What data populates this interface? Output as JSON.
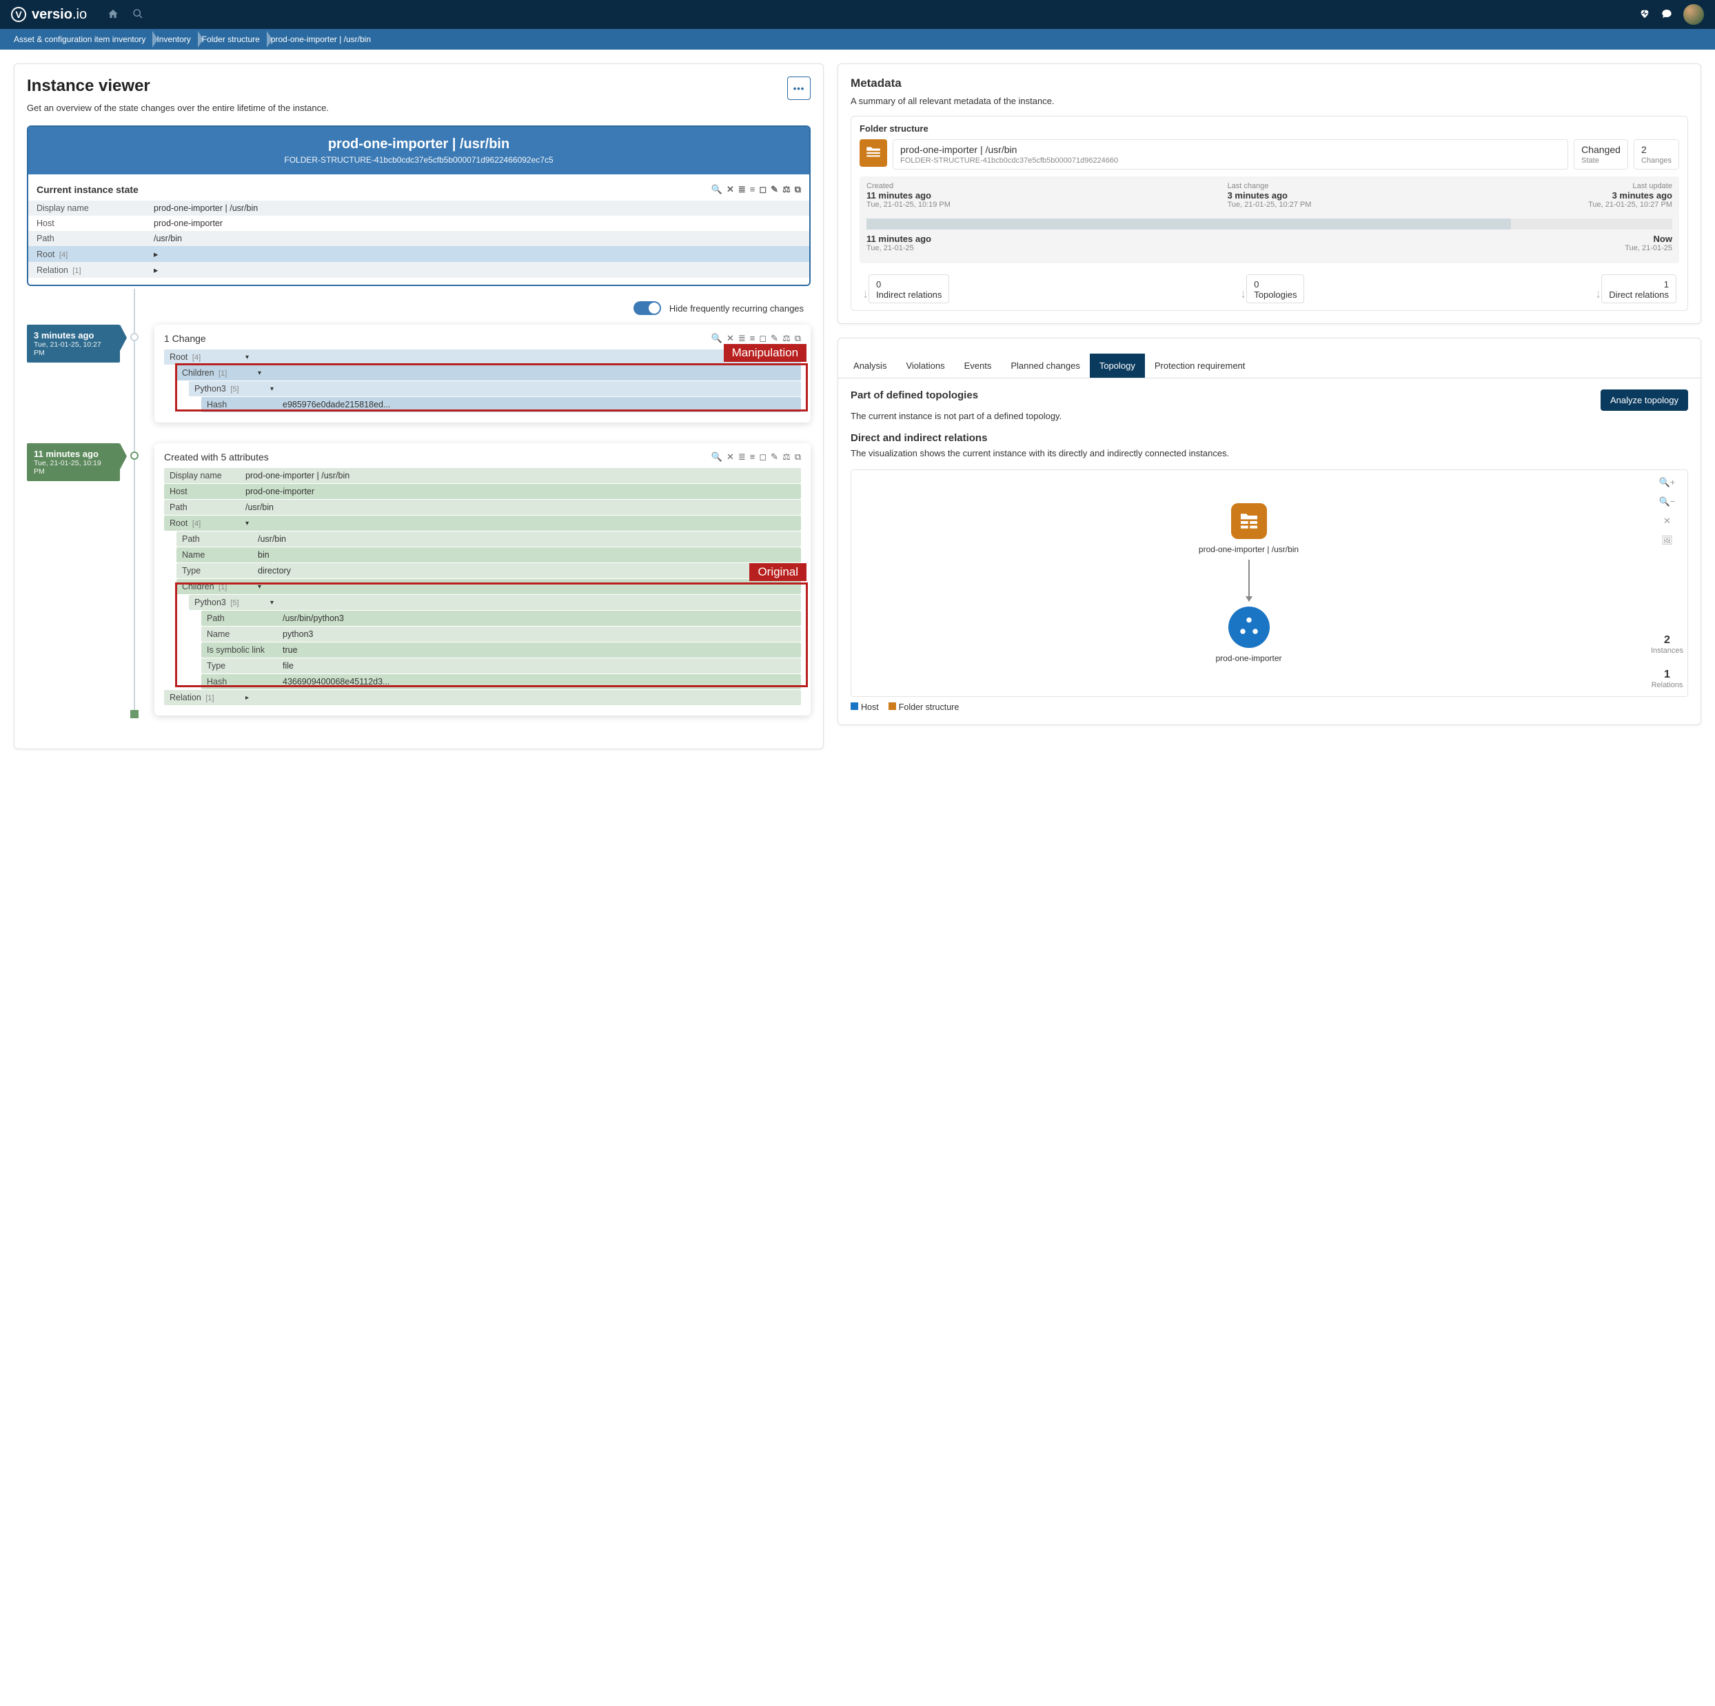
{
  "nav": {
    "brand_bold": "versio",
    "brand_light": ".io"
  },
  "breadcrumb": [
    "Asset & configuration item inventory",
    "Inventory",
    "Folder structure",
    "prod-one-importer | /usr/bin"
  ],
  "viewer": {
    "title": "Instance viewer",
    "desc": "Get an overview of the state changes over the entire lifetime of the instance.",
    "instance_name": "prod-one-importer | /usr/bin",
    "instance_id": "FOLDER-STRUCTURE-41bcb0cdc37e5cfb5b000071d9622466092ec7c5",
    "current_title": "Current instance state",
    "current_rows": [
      {
        "k": "Display name",
        "v": "prod-one-importer | /usr/bin"
      },
      {
        "k": "Host",
        "v": "prod-one-importer"
      },
      {
        "k": "Path",
        "v": "/usr/bin"
      }
    ],
    "root_label": "Root",
    "root_count": "[4]",
    "relation_label": "Relation",
    "relation_count": "[1]",
    "hide_label": "Hide frequently recurring changes"
  },
  "timeline": {
    "e1": {
      "ago": "3 minutes ago",
      "dt": "Tue, 21-01-25, 10:27 PM",
      "title": "1 Change",
      "callout": "Manipulation",
      "root": "Root",
      "root_c": "[4]",
      "children": "Children",
      "children_c": "[1]",
      "py": "Python3",
      "py_c": "[5]",
      "hash_k": "Hash",
      "hash_v": "e985976e0dade215818ed..."
    },
    "e2": {
      "ago": "11 minutes ago",
      "dt": "Tue, 21-01-25, 10:19 PM",
      "title": "Created with 5 attributes",
      "callout": "Original",
      "rows": [
        {
          "k": "Display name",
          "v": "prod-one-importer | /usr/bin"
        },
        {
          "k": "Host",
          "v": "prod-one-importer"
        },
        {
          "k": "Path",
          "v": "/usr/bin"
        }
      ],
      "root": "Root",
      "root_c": "[4]",
      "rootrows": [
        {
          "k": "Path",
          "v": "/usr/bin"
        },
        {
          "k": "Name",
          "v": "bin"
        },
        {
          "k": "Type",
          "v": "directory"
        }
      ],
      "children": "Children",
      "children_c": "[1]",
      "py": "Python3",
      "py_c": "[5]",
      "pyrows": [
        {
          "k": "Path",
          "v": "/usr/bin/python3"
        },
        {
          "k": "Name",
          "v": "python3"
        },
        {
          "k": "Is symbolic link",
          "v": "true"
        },
        {
          "k": "Type",
          "v": "file"
        },
        {
          "k": "Hash",
          "v": "4366909400068e45112d3..."
        }
      ],
      "relation": "Relation",
      "relation_c": "[1]"
    }
  },
  "meta": {
    "title": "Metadata",
    "desc": "A summary of all relevant metadata of the instance.",
    "section": "Folder structure",
    "name": "prod-one-importer | /usr/bin",
    "id": "FOLDER-STRUCTURE-41bcb0cdc37e5cfb5b000071d96224660",
    "state_v": "Changed",
    "state_l": "State",
    "changes_v": "2",
    "changes_l": "Changes",
    "created_l": "Created",
    "created_v": "11 minutes ago",
    "created_d": "Tue, 21-01-25, 10:19 PM",
    "lastchange_l": "Last change",
    "lastchange_v": "3 minutes ago",
    "lastchange_d": "Tue, 21-01-25, 10:27 PM",
    "lastupdate_l": "Last update",
    "lastupdate_v": "3 minutes ago",
    "lastupdate_d": "Tue, 21-01-25, 10:27 PM",
    "bar_left_v": "11 minutes ago",
    "bar_left_d": "Tue, 21-01-25",
    "bar_right_v": "Now",
    "bar_right_d": "Tue, 21-01-25",
    "indirect_n": "0",
    "indirect_l": "Indirect relations",
    "topo_n": "0",
    "topo_l": "Topologies",
    "direct_n": "1",
    "direct_l": "Direct relations"
  },
  "tabs": {
    "analysis": "Analysis",
    "violations": "Violations",
    "events": "Events",
    "planned": "Planned changes",
    "topology": "Topology",
    "protection": "Protection requirement"
  },
  "topo": {
    "title1": "Part of defined topologies",
    "analyze": "Analyze topology",
    "desc1": "The current instance is not part of a defined topology.",
    "title2": "Direct and indirect relations",
    "desc2": "The visualization shows the current instance with its directly and indirectly connected instances.",
    "node1": "prod-one-importer | /usr/bin",
    "node2": "prod-one-importer",
    "inst_n": "2",
    "inst_l": "Instances",
    "rel_n": "1",
    "rel_l": "Relations",
    "legend_host": "Host",
    "legend_fs": "Folder structure"
  }
}
